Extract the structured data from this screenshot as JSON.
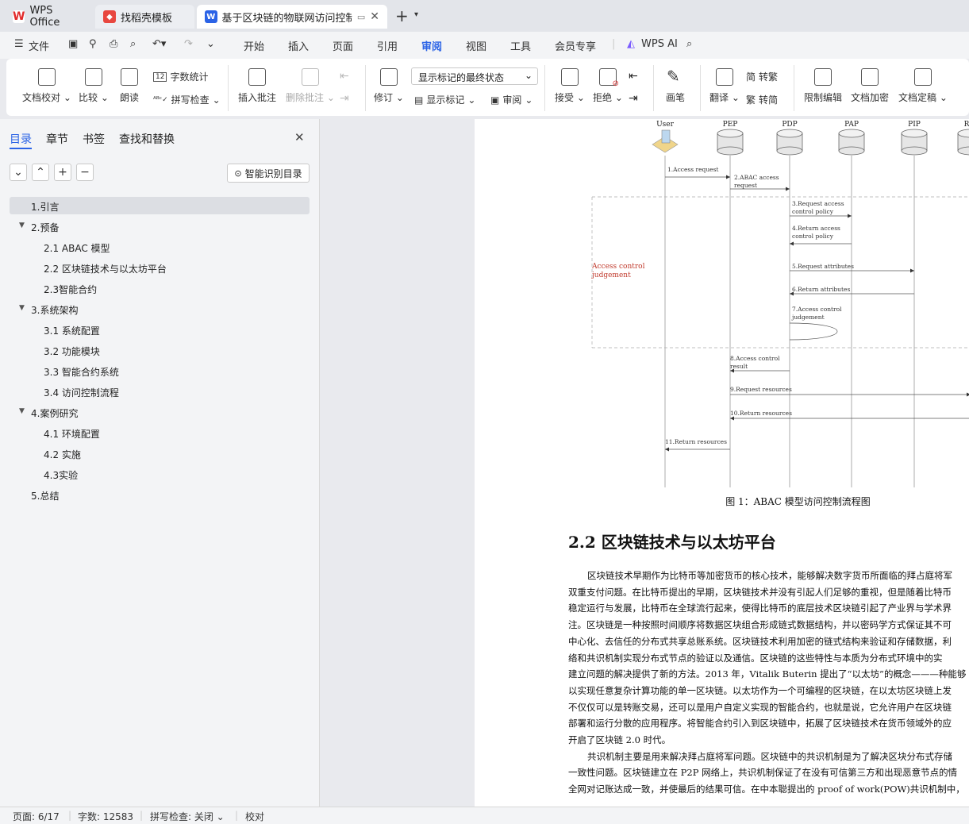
{
  "tabs": [
    {
      "label": "WPS Office",
      "icon": "wps-icon",
      "color": "#e12a2a"
    },
    {
      "label": "找稻壳模板",
      "icon": "docer-icon",
      "color": "#e8473f"
    },
    {
      "label": "基于区块链的物联网访问控制",
      "icon": "writer-icon",
      "color": "#2b63e6"
    }
  ],
  "menubar": {
    "file": "文件",
    "items": [
      "开始",
      "插入",
      "页面",
      "引用",
      "审阅",
      "视图",
      "工具",
      "会员专享"
    ],
    "active": "审阅",
    "wps_ai": "WPS AI"
  },
  "ribbon": {
    "doc_check": "文档校对",
    "compare": "比较",
    "read_aloud": "朗读",
    "word_count": "字数统计",
    "spell_check": "拼写检查",
    "insert_comment": "插入批注",
    "delete_comment": "删除批注",
    "revise": "修订",
    "display_state": "显示标记的最终状态",
    "show_markup": "显示标记",
    "review": "审阅",
    "accept": "接受",
    "reject": "拒绝",
    "pen": "画笔",
    "translate": "翻译",
    "to_trad": "转繁",
    "to_simp": "转简",
    "restrict": "限制编辑",
    "encrypt": "文档加密",
    "finalize": "文档定稿"
  },
  "sidebar": {
    "tabs": [
      "目录",
      "章节",
      "书签",
      "查找和替换"
    ],
    "active_tab": "目录",
    "smart_toc": "智能识别目录",
    "toc": [
      {
        "label": "1.引言",
        "level": 1,
        "expand": "",
        "selected": true
      },
      {
        "label": "2.预备",
        "level": 1,
        "expand": "▼",
        "selected": false
      },
      {
        "label": "2.1 ABAC 模型",
        "level": 2,
        "expand": "",
        "selected": false
      },
      {
        "label": "2.2  区块链技术与以太坊平台",
        "level": 2,
        "expand": "",
        "selected": false
      },
      {
        "label": "2.3智能合约",
        "level": 2,
        "expand": "",
        "selected": false
      },
      {
        "label": "3.系统架构",
        "level": 1,
        "expand": "▼",
        "selected": false
      },
      {
        "label": "3.1  系统配置",
        "level": 2,
        "expand": "",
        "selected": false
      },
      {
        "label": "3.2  功能模块",
        "level": 2,
        "expand": "",
        "selected": false
      },
      {
        "label": "3.3  智能合约系统",
        "level": 2,
        "expand": "",
        "selected": false
      },
      {
        "label": "3.4  访问控制流程",
        "level": 2,
        "expand": "",
        "selected": false
      },
      {
        "label": "4.案例研究",
        "level": 1,
        "expand": "▼",
        "selected": false
      },
      {
        "label": "4.1 环境配置",
        "level": 2,
        "expand": "",
        "selected": false
      },
      {
        "label": "4.2  实施",
        "level": 2,
        "expand": "",
        "selected": false
      },
      {
        "label": "4.3实验",
        "level": 2,
        "expand": "",
        "selected": false
      },
      {
        "label": "5.总结",
        "level": 1,
        "expand": "",
        "selected": false
      }
    ]
  },
  "diagram": {
    "actors": [
      "User",
      "PEP",
      "PDP",
      "PAP",
      "PIP",
      "Res"
    ],
    "group_label": [
      "Access control",
      "judgement"
    ],
    "messages": [
      [
        "1.Access request"
      ],
      [
        "2.ABAC access",
        "request"
      ],
      [
        "3.Request access",
        "control policy"
      ],
      [
        "4.Return access",
        "control policy"
      ],
      [
        "5.Request attributes"
      ],
      [
        "6.Return attributes"
      ],
      [
        "7.Access control",
        "judgement"
      ],
      [
        "8.Access control",
        "result"
      ],
      [
        "9.Request resources"
      ],
      [
        "10.Return resources"
      ],
      [
        "11.Return resources"
      ]
    ],
    "caption": "图 1：ABAC 模型访问控制流程图"
  },
  "document": {
    "heading": "2.2  区块链技术与以太坊平台",
    "lines": [
      "区块链技术早期作为比特币等加密货币的核心技术，能够解决数字货币所面临的拜占庭将军",
      "双重支付问题。在比特币提出的早期，区块链技术并没有引起人们足够的重视，但是随着比特币",
      "稳定运行与发展，比特币在全球流行起来，使得比特币的底层技术区块链引起了产业界与学术界",
      "注。区块链是一种按照时间顺序将数据区块组合形成链式数据结构，并以密码学方式保证其不可",
      "中心化、去信任的分布式共享总账系统。区块链技术利用加密的链式结构来验证和存储数据，利",
      "络和共识机制实现分布式节点的验证以及通信。区块链的这些特性与本质为分布式环境中的实",
      "建立问题的解决提供了新的方法。2013 年，Vitalik Buterin 提出了“以太坊”的概念———种能够",
      "以实现任意复杂计算功能的单一区块链。以太坊作为一个可编程的区块链，在以太坊区块链上发",
      "不仅仅可以是转账交易，还可以是用户自定义实现的智能合约，也就是说，它允许用户在区块链",
      "部署和运行分散的应用程序。将智能合约引入到区块链中，拓展了区块链技术在货币领域外的应",
      "开启了区块链 2.0 时代。",
      "共识机制主要是用来解决拜占庭将军问题。区块链中的共识机制是为了解决区块分布式存储",
      "一致性问题。区块链建立在 P2P 网络上，共识机制保证了在没有可信第三方和出现恶意节点的情",
      "全网对记账达成一致，并使最后的结果可信。在中本聪提出的 proof of work(POW)共识机制中，"
    ]
  },
  "status": {
    "page": "页面: 6/17",
    "words": "字数: 12583",
    "spell": "拼写检查: 关闭",
    "proof": "校对"
  }
}
